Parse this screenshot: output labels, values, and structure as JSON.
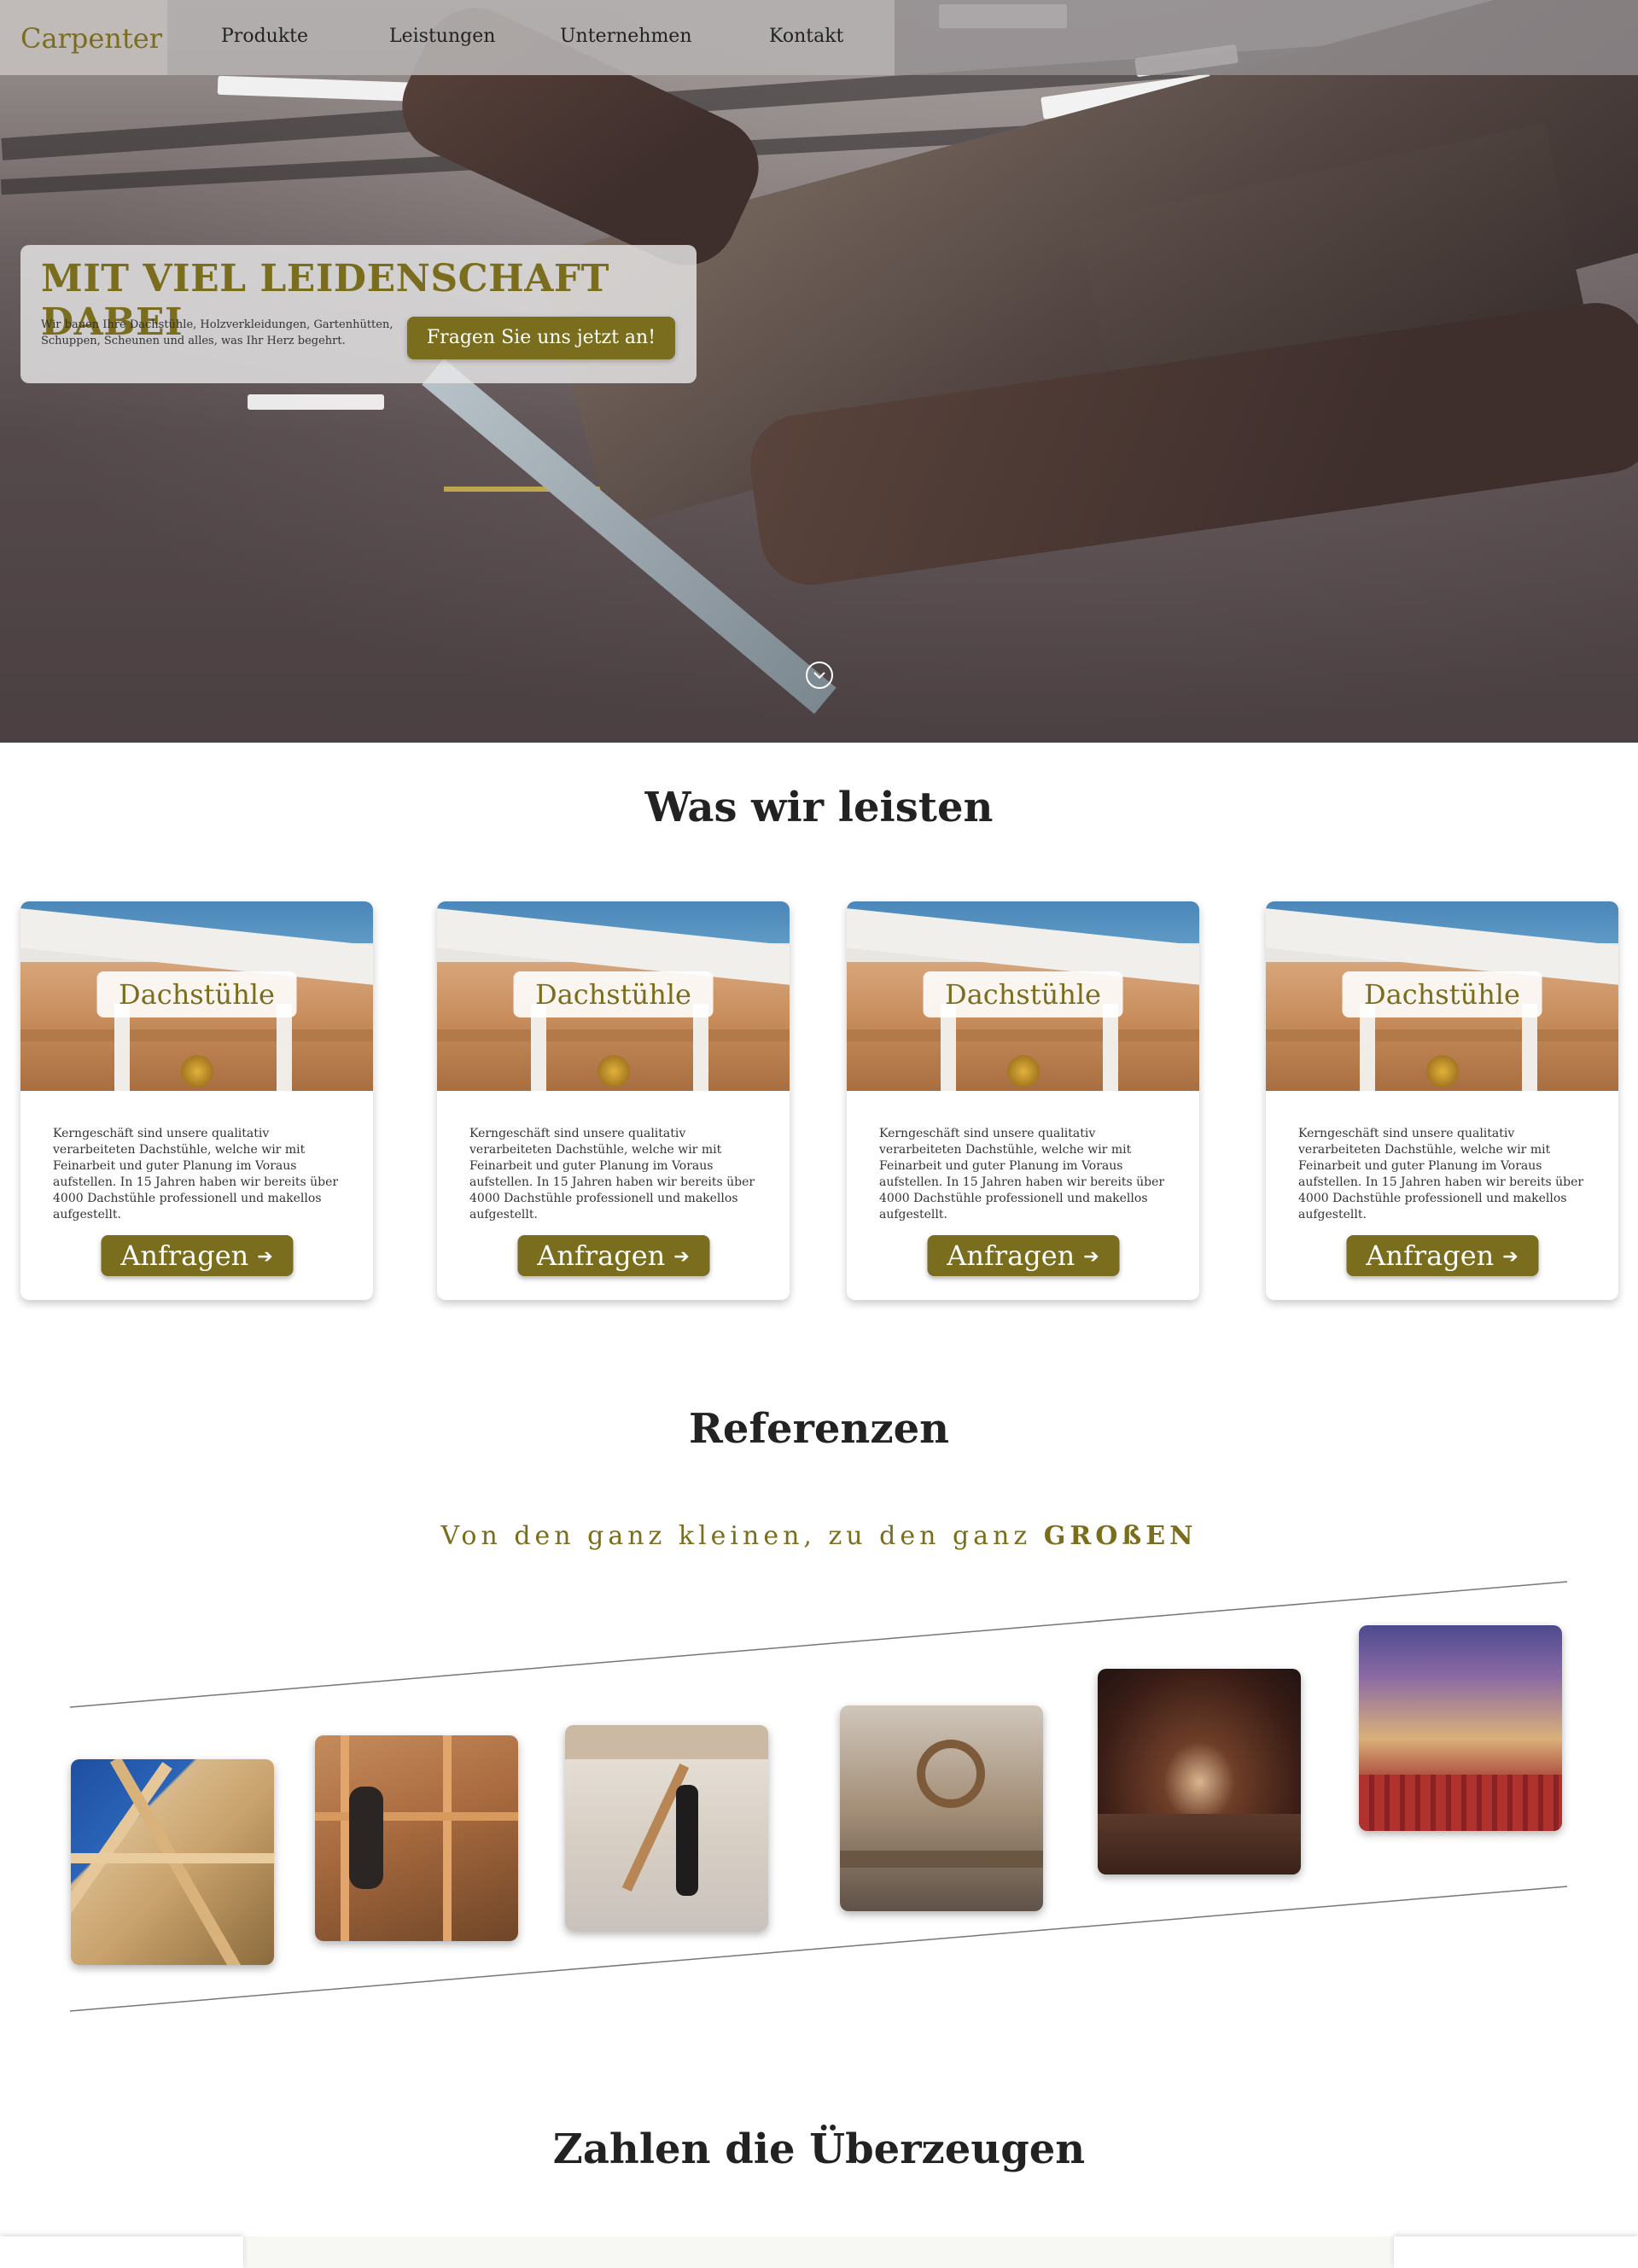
{
  "header": {
    "brand": "Carpenter",
    "nav": [
      "Produkte",
      "Leistungen",
      "Unternehmen",
      "Kontakt"
    ]
  },
  "hero": {
    "title": "MIT VIEL LEIDENSCHAFT DABEI",
    "text": "Wir bauen Ihre Dachstühle, Holzverkleidungen, Gartenhütten, Schuppen, Scheunen und alles, was Ihr Herz begehrt.",
    "cta": "Fragen Sie uns jetzt an!",
    "scroll_icon": "chevron-down-circle-icon"
  },
  "services": {
    "title": "Was wir leisten",
    "cards": [
      {
        "label": "Dachstühle",
        "text": "Kerngeschäft sind unsere qualitativ verarbeiteten Dachstühle, welche wir mit Feinarbeit und guter Planung im Voraus aufstellen. In 15 Jahren haben wir bereits über 4000 Dachstühle professionell und makellos aufgestellt.",
        "button": "Anfragen"
      },
      {
        "label": "Dachstühle",
        "text": "Kerngeschäft sind unsere qualitativ verarbeiteten Dachstühle, welche wir mit Feinarbeit und guter Planung im Voraus aufstellen. In 15 Jahren haben wir bereits über 4000 Dachstühle professionell und makellos aufgestellt.",
        "button": "Anfragen"
      },
      {
        "label": "Dachstühle",
        "text": "Kerngeschäft sind unsere qualitativ verarbeiteten Dachstühle, welche wir mit Feinarbeit und guter Planung im Voraus aufstellen. In 15 Jahren haben wir bereits über 4000 Dachstühle professionell und makellos aufgestellt.",
        "button": "Anfragen"
      },
      {
        "label": "Dachstühle",
        "text": "Kerngeschäft sind unsere qualitativ verarbeiteten Dachstühle, welche wir mit Feinarbeit und guter Planung im Voraus aufstellen. In 15 Jahren haben wir bereits über 4000 Dachstühle professionell und makellos aufgestellt.",
        "button": "Anfragen"
      }
    ]
  },
  "references": {
    "title": "Referenzen",
    "subtitle_prefix": "Von den ganz kleinen, zu den ganz ",
    "subtitle_emphasis": "GROßEN"
  },
  "stats": {
    "title": "Zahlen die Überzeugen"
  },
  "colors": {
    "accent": "#7a6d1e",
    "text": "#222222"
  }
}
